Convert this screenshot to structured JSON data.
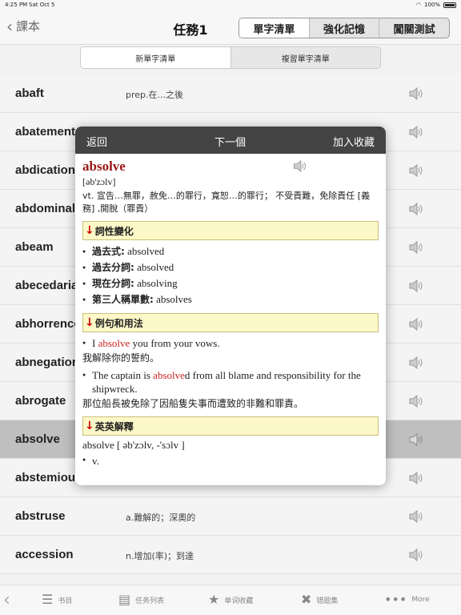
{
  "status": {
    "time": "4:25 PM",
    "date": "Sat Oct 5",
    "battery": "100%"
  },
  "nav": {
    "back_label": "課本",
    "title": "任務1",
    "segments": [
      "單字清單",
      "強化記憶",
      "闖關測試"
    ]
  },
  "subtabs": [
    "新單字清單",
    "複習單字清單"
  ],
  "words": [
    {
      "word": "abaft",
      "def": "prep.在...之後"
    },
    {
      "word": "abatement",
      "def": ""
    },
    {
      "word": "abdication",
      "def": ""
    },
    {
      "word": "abdominal",
      "def": ""
    },
    {
      "word": "abeam",
      "def": ""
    },
    {
      "word": "abecedarian",
      "def": ""
    },
    {
      "word": "abhorrence",
      "def": ""
    },
    {
      "word": "abnegation",
      "def": ""
    },
    {
      "word": "abrogate",
      "def": ""
    },
    {
      "word": "absolve",
      "def": ""
    },
    {
      "word": "abstemious",
      "def": ""
    },
    {
      "word": "abstruse",
      "def": "a.難解的；深奧的"
    },
    {
      "word": "accession",
      "def": "n.增加(率)；到達"
    }
  ],
  "popover": {
    "back": "返回",
    "next": "下一個",
    "favorite": "加入收藏",
    "headword": "absolve",
    "phonetic": "[əb'zɔlv]",
    "meaning": "vt. 宣告…無罪，赦免…的罪行，寬恕…的罪行； 不受責難，免除責任 [義務] ,開脫（罪責）",
    "section_forms": "詞性變化",
    "forms": [
      {
        "label": "過去式:",
        "value": "absolved"
      },
      {
        "label": "過去分詞:",
        "value": "absolved"
      },
      {
        "label": "現在分詞:",
        "value": "absolving"
      },
      {
        "label": "第三人稱單數:",
        "value": "absolves"
      }
    ],
    "section_examples": "例句和用法",
    "ex1_before": "I ",
    "ex1_hl": "absolve",
    "ex1_after": " you from your vows.",
    "ex1_zh": "我解除你的誓約。",
    "ex2_before": "The captain is ",
    "ex2_hl": "absolve",
    "ex2_after": "d from all blame and responsibility for the shipwreck.",
    "ex2_zh": "那位船長被免除了因船隻失事而遭致的非難和罪責。",
    "section_english": "英英解釋",
    "eng_head": "absolve [ əb'zɔlv, -'sɔlv ]",
    "eng_pos": "v."
  },
  "tabbar": [
    "书目",
    "任务列表",
    "单词收藏",
    "错题集",
    "More"
  ]
}
